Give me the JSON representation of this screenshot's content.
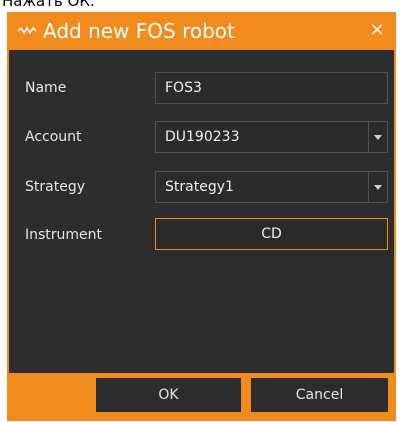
{
  "caption": "Нажать ОК.",
  "dialog": {
    "title": "Add new FOS robot",
    "close_glyph": "×",
    "logo_icon": "wave-icon",
    "accent_color": "#f28b1d",
    "background_color": "#2d2d30"
  },
  "form": {
    "name_label": "Name",
    "name_value": "FOS3",
    "account_label": "Account",
    "account_value": "DU190233",
    "strategy_label": "Strategy",
    "strategy_value": "Strategy1",
    "instrument_label": "Instrument",
    "instrument_value": "CD"
  },
  "buttons": {
    "ok_label": "OK",
    "cancel_label": "Cancel"
  }
}
